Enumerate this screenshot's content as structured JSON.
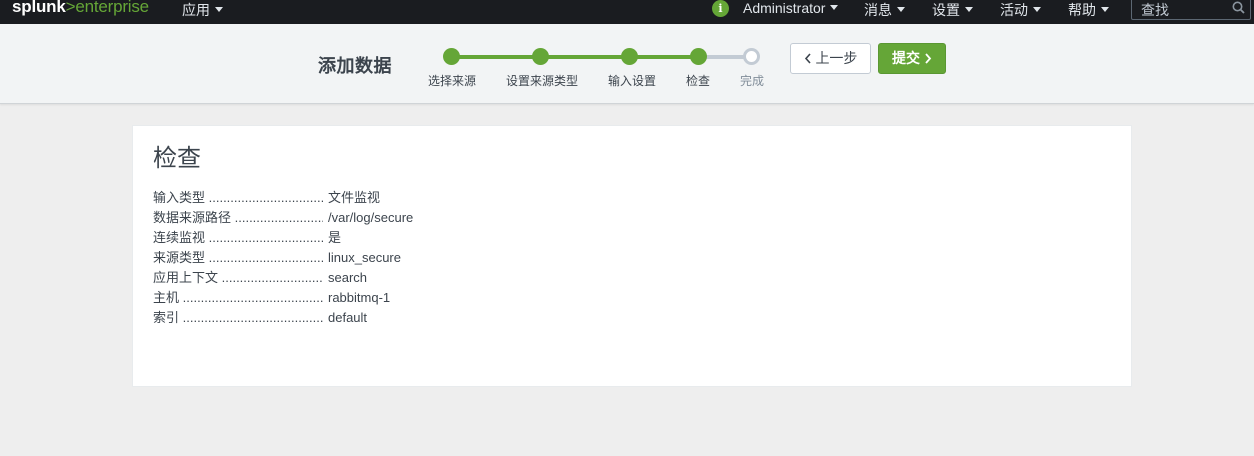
{
  "topbar": {
    "logo_splunk": "splunk",
    "logo_gt": ">",
    "logo_enterprise": "enterprise",
    "apps_label": "应用",
    "info_icon": "i",
    "user_label": "Administrator",
    "messages_label": "消息",
    "settings_label": "设置",
    "activity_label": "活动",
    "help_label": "帮助",
    "search_placeholder": "查找"
  },
  "wizard": {
    "title": "添加数据",
    "steps": [
      {
        "label": "选择来源",
        "state": "done"
      },
      {
        "label": "设置来源类型",
        "state": "done"
      },
      {
        "label": "输入设置",
        "state": "done"
      },
      {
        "label": "检查",
        "state": "current"
      },
      {
        "label": "完成",
        "state": "todo"
      }
    ],
    "back_label": "上一步",
    "submit_label": "提交"
  },
  "review": {
    "title": "检查",
    "rows": [
      {
        "key": "输入类型",
        "value": "文件监视"
      },
      {
        "key": "数据来源路径",
        "value": "/var/log/secure"
      },
      {
        "key": "连续监视",
        "value": "是"
      },
      {
        "key": "来源类型",
        "value": "linux_secure"
      },
      {
        "key": "应用上下文",
        "value": "search"
      },
      {
        "key": "主机",
        "value": "rabbitmq-1"
      },
      {
        "key": "索引",
        "value": "default"
      }
    ]
  },
  "colors": {
    "accent": "#65a637",
    "topbar": "#1a1c20",
    "step_todo": "#c3cbd4"
  }
}
